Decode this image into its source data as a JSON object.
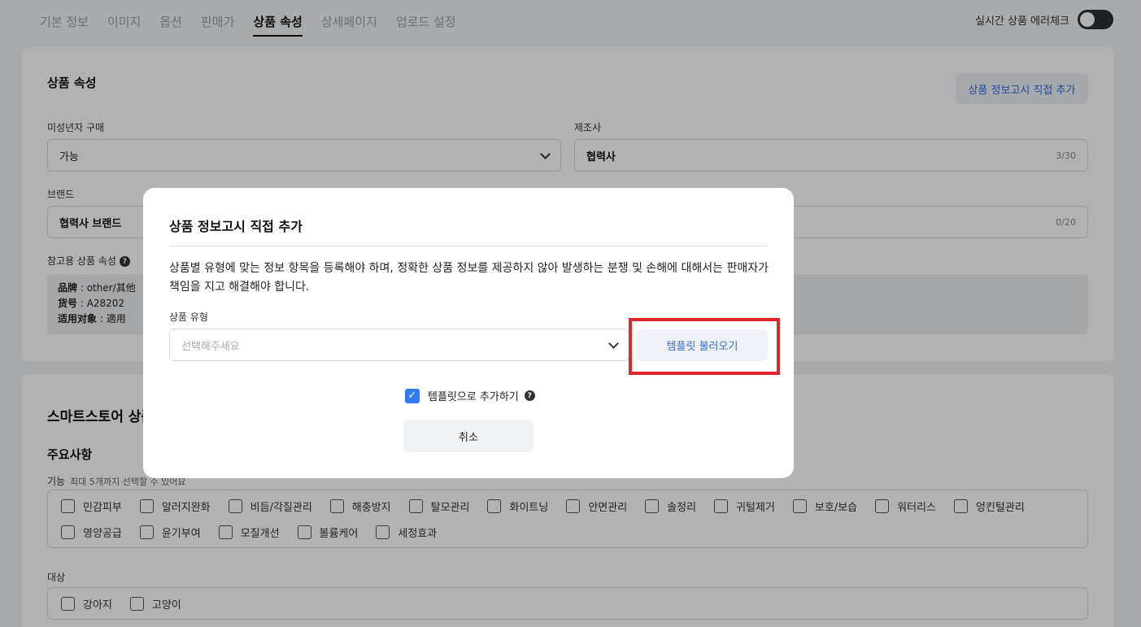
{
  "tabs": [
    "기본 정보",
    "이미지",
    "옵션",
    "판매가",
    "상품 속성",
    "상세페이지",
    "업로드 설정"
  ],
  "active_tab": "상품 속성",
  "realtime_check": {
    "label": "실시간 상품 에러체크",
    "enabled": false
  },
  "attributes": {
    "title": "상품 속성",
    "add_notice_button": "상품 정보고시 직접 추가",
    "minor_purchase": {
      "label": "미성년자 구매",
      "value": "가능"
    },
    "manufacturer": {
      "label": "제조사",
      "value": "협력사",
      "counter": "3/30"
    },
    "brand": {
      "label": "브랜드",
      "value": "협력사 브랜드",
      "counter": "0/20"
    },
    "reference": {
      "label": "참고용 상품 속성",
      "lines": [
        {
          "key": "品牌",
          "value": "other/其他"
        },
        {
          "key": "货号",
          "value": "A28202"
        },
        {
          "key": "适用对象",
          "value": "適用"
        }
      ]
    }
  },
  "smartstore": {
    "title": "스마트스토어 상품",
    "subtitle": "주요사항",
    "function": {
      "label": "기능",
      "hint": "최대 5개까지 선택할 수 있어요",
      "options": [
        "민감피부",
        "알러지완화",
        "비듬/각질관리",
        "해충방지",
        "탈모관리",
        "화이트닝",
        "안면관리",
        "솔정리",
        "귀털제거",
        "보호/보습",
        "워터리스",
        "엉킨털관리",
        "영양공급",
        "윤기부여",
        "모질개선",
        "볼륨케어",
        "세정효과"
      ]
    },
    "target": {
      "label": "대상",
      "options": [
        "강아지",
        "고양이"
      ]
    }
  },
  "modal": {
    "title": "상품 정보고시 직접 추가",
    "description": "상품별 유형에 맞는 정보 항목을 등록해야 하며, 정확한 상품 정보를 제공하지 않아 발생하는 분쟁 및 손해에 대해서는 판매자가 책임을 지고 해결해야 합니다.",
    "type_label": "상품 유형",
    "type_placeholder": "선택해주세요",
    "load_template_button": "템플릿 불러오기",
    "add_as_template": {
      "label": "템플릿으로 추가하기",
      "checked": true
    },
    "cancel_button": "취소"
  },
  "colors": {
    "accent": "#2f7cf6",
    "highlight": "#e0262b",
    "link": "#2d6fd6"
  }
}
